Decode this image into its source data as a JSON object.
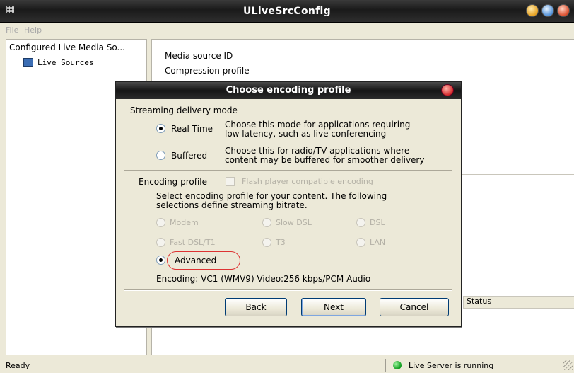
{
  "window": {
    "title": "ULiveSrcConfig"
  },
  "menu": {
    "items": [
      "File",
      "Help"
    ]
  },
  "tree": {
    "root": "Configured Live Media So...",
    "child": "Live Sources"
  },
  "properties": {
    "labels": [
      "Media source ID",
      "Compression profile"
    ]
  },
  "table": {
    "status_header": "Status"
  },
  "status_bar": {
    "left": "Ready",
    "server": "Live Server is running"
  },
  "dialog": {
    "title": "Choose encoding profile",
    "delivery": {
      "heading": "Streaming delivery mode",
      "realtime_label": "Real Time",
      "realtime_desc": [
        "Choose this mode for applications requiring",
        "low latency, such as live conferencing"
      ],
      "buffered_label": "Buffered",
      "buffered_desc": [
        "Choose this for radio/TV applications where",
        "content may be buffered for smoother delivery"
      ],
      "selected": "Real Time"
    },
    "profile": {
      "heading": "Encoding profile",
      "flash_label": "Flash player compatible encoding",
      "flash_checked": false,
      "instructions": [
        "Select encoding profile for your content. The following",
        "selections define streaming bitrate."
      ],
      "options": [
        "Modem",
        "Slow DSL",
        "DSL",
        "Fast DSL/T1",
        "T3",
        "LAN"
      ],
      "advanced_label": "Advanced",
      "selected": "Advanced",
      "encoding_summary": "Encoding: VC1 (WMV9) Video:256 kbps/PCM Audio"
    },
    "buttons": {
      "back": "Back",
      "next": "Next",
      "cancel": "Cancel"
    }
  }
}
